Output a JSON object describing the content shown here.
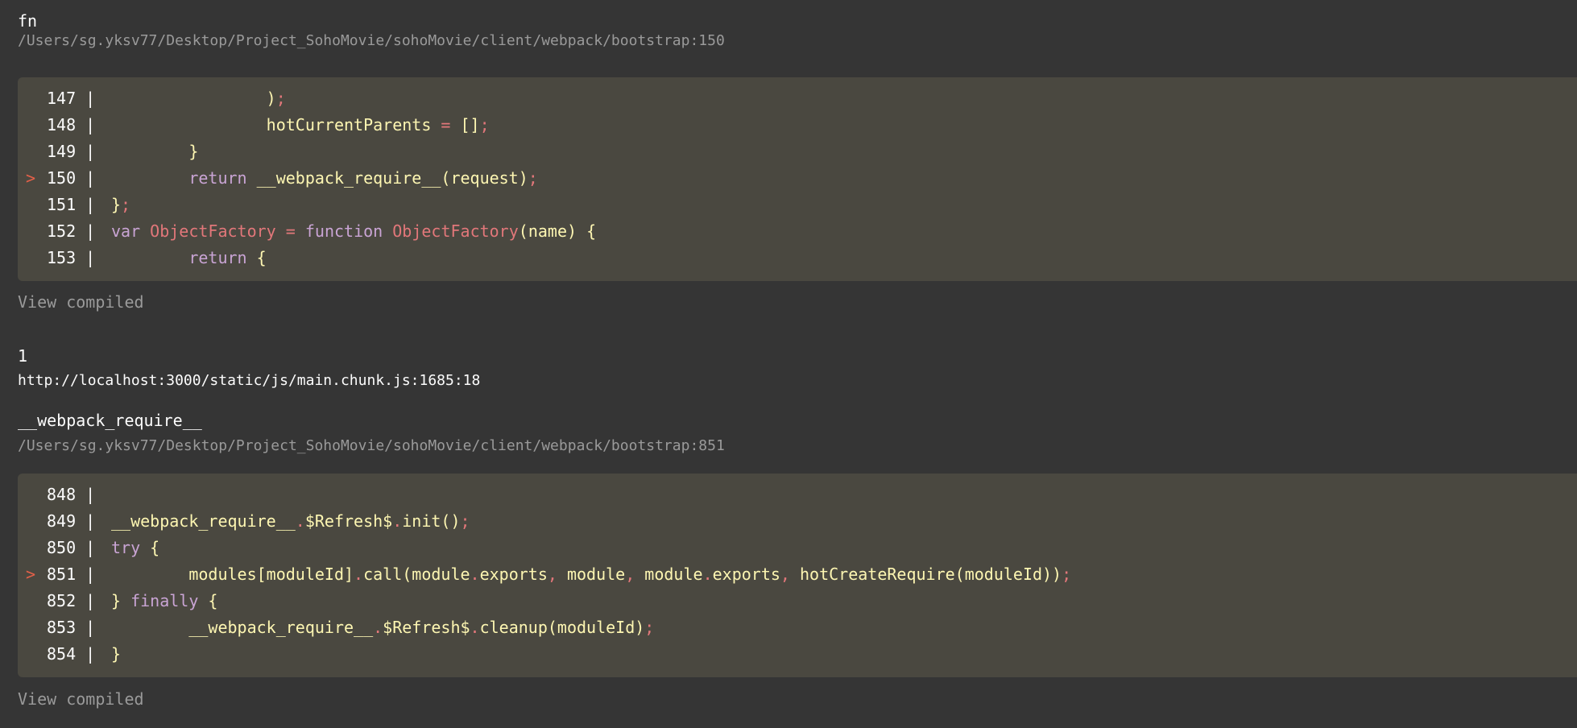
{
  "frames": [
    {
      "title": "fn",
      "path": "/Users/sg.yksv77/Desktop/Project_SohoMovie/sohoMovie/client/webpack/bootstrap:150",
      "view_compiled_label": "View compiled",
      "lines": [
        {
          "number": "147",
          "highlighted": false,
          "tokens": [
            {
              "t": "                ",
              "c": "plain"
            },
            {
              "t": ")",
              "c": "plain"
            },
            {
              "t": ";",
              "c": "op"
            }
          ]
        },
        {
          "number": "148",
          "highlighted": false,
          "tokens": [
            {
              "t": "                ",
              "c": "plain"
            },
            {
              "t": "hotCurrentParents ",
              "c": "plain"
            },
            {
              "t": "=",
              "c": "op"
            },
            {
              "t": " []",
              "c": "plain"
            },
            {
              "t": ";",
              "c": "op"
            }
          ]
        },
        {
          "number": "149",
          "highlighted": false,
          "tokens": [
            {
              "t": "        }",
              "c": "plain"
            }
          ]
        },
        {
          "number": "150",
          "highlighted": true,
          "tokens": [
            {
              "t": "        ",
              "c": "plain"
            },
            {
              "t": "return",
              "c": "kw"
            },
            {
              "t": " __webpack_require__(request)",
              "c": "plain"
            },
            {
              "t": ";",
              "c": "op"
            }
          ]
        },
        {
          "number": "151",
          "highlighted": false,
          "tokens": [
            {
              "t": "}",
              "c": "plain"
            },
            {
              "t": ";",
              "c": "op"
            }
          ]
        },
        {
          "number": "152",
          "highlighted": false,
          "tokens": [
            {
              "t": "var",
              "c": "kw"
            },
            {
              "t": " ",
              "c": "plain"
            },
            {
              "t": "ObjectFactory",
              "c": "fn"
            },
            {
              "t": " ",
              "c": "plain"
            },
            {
              "t": "=",
              "c": "op"
            },
            {
              "t": " ",
              "c": "plain"
            },
            {
              "t": "function",
              "c": "kw"
            },
            {
              "t": " ",
              "c": "plain"
            },
            {
              "t": "ObjectFactory",
              "c": "fn"
            },
            {
              "t": "(name) {",
              "c": "plain"
            }
          ]
        },
        {
          "number": "153",
          "highlighted": false,
          "tokens": [
            {
              "t": "        ",
              "c": "plain"
            },
            {
              "t": "return",
              "c": "kw"
            },
            {
              "t": " {",
              "c": "plain"
            }
          ]
        }
      ]
    },
    {
      "title": "1",
      "url": "http://localhost:3000/static/js/main.chunk.js:1685:18"
    },
    {
      "title": "__webpack_require__",
      "path": "/Users/sg.yksv77/Desktop/Project_SohoMovie/sohoMovie/client/webpack/bootstrap:851",
      "view_compiled_label": "View compiled",
      "lines": [
        {
          "number": "848",
          "highlighted": false,
          "tokens": []
        },
        {
          "number": "849",
          "highlighted": false,
          "tokens": [
            {
              "t": "__webpack_require__",
              "c": "plain"
            },
            {
              "t": ".",
              "c": "op"
            },
            {
              "t": "$Refresh$",
              "c": "plain"
            },
            {
              "t": ".",
              "c": "op"
            },
            {
              "t": "init()",
              "c": "plain"
            },
            {
              "t": ";",
              "c": "op"
            }
          ]
        },
        {
          "number": "850",
          "highlighted": false,
          "tokens": [
            {
              "t": "try",
              "c": "kw"
            },
            {
              "t": " {",
              "c": "plain"
            }
          ]
        },
        {
          "number": "851",
          "highlighted": true,
          "tokens": [
            {
              "t": "        modules[moduleId]",
              "c": "plain"
            },
            {
              "t": ".",
              "c": "op"
            },
            {
              "t": "call(module",
              "c": "plain"
            },
            {
              "t": ".",
              "c": "op"
            },
            {
              "t": "exports",
              "c": "plain"
            },
            {
              "t": ",",
              "c": "op"
            },
            {
              "t": " module",
              "c": "plain"
            },
            {
              "t": ",",
              "c": "op"
            },
            {
              "t": " module",
              "c": "plain"
            },
            {
              "t": ".",
              "c": "op"
            },
            {
              "t": "exports",
              "c": "plain"
            },
            {
              "t": ",",
              "c": "op"
            },
            {
              "t": " hotCreateRequire(moduleId))",
              "c": "plain"
            },
            {
              "t": ";",
              "c": "op"
            }
          ]
        },
        {
          "number": "852",
          "highlighted": false,
          "tokens": [
            {
              "t": "} ",
              "c": "plain"
            },
            {
              "t": "finally",
              "c": "kw"
            },
            {
              "t": " {",
              "c": "plain"
            }
          ]
        },
        {
          "number": "853",
          "highlighted": false,
          "tokens": [
            {
              "t": "        __webpack_require__",
              "c": "plain"
            },
            {
              "t": ".",
              "c": "op"
            },
            {
              "t": "$Refresh$",
              "c": "plain"
            },
            {
              "t": ".",
              "c": "op"
            },
            {
              "t": "cleanup(moduleId)",
              "c": "plain"
            },
            {
              "t": ";",
              "c": "op"
            }
          ]
        },
        {
          "number": "854",
          "highlighted": false,
          "tokens": [
            {
              "t": "}",
              "c": "plain"
            }
          ]
        }
      ]
    }
  ],
  "markers": {
    "highlight": ">",
    "separator": "|"
  },
  "colors": {
    "background": "#353535",
    "code_background": "#4a4840",
    "keyword": "#c9a4d4",
    "function_name": "#e2777a",
    "operator": "#e2777a",
    "text": "#fdf6b2",
    "path": "#9a9a9a",
    "marker": "#e36049"
  }
}
